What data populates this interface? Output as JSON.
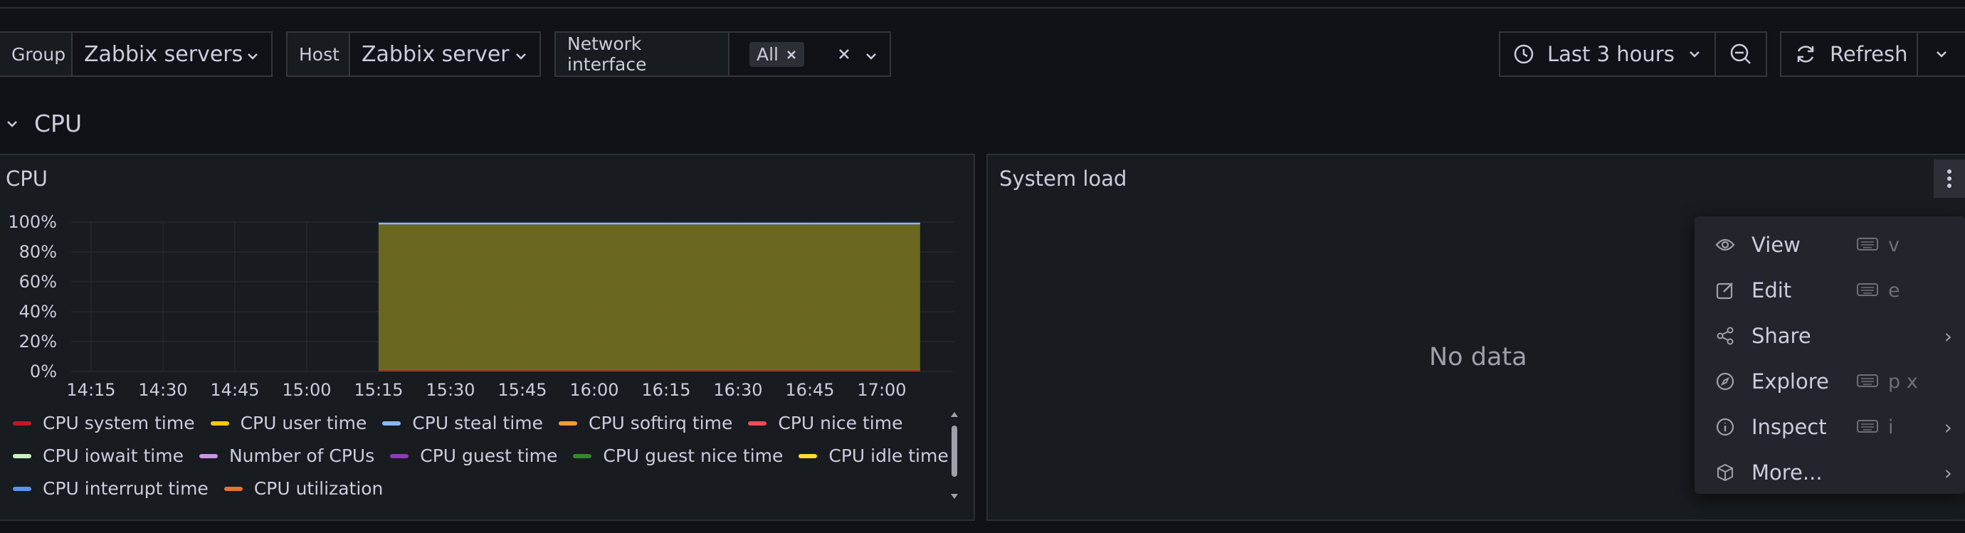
{
  "variables": {
    "group": {
      "label": "Group",
      "value": "Zabbix servers"
    },
    "host": {
      "label": "Host",
      "value": "Zabbix server"
    },
    "network": {
      "label": "Network interface",
      "chip": "All"
    }
  },
  "toolbar": {
    "time_range": "Last 3 hours",
    "refresh": "Refresh"
  },
  "row": {
    "title": "CPU"
  },
  "cpu_panel": {
    "title": "CPU",
    "chart_data": {
      "type": "area",
      "y_ticks": [
        "100%",
        "80%",
        "60%",
        "40%",
        "20%",
        "0%"
      ],
      "x_ticks": [
        "14:15",
        "14:30",
        "14:45",
        "15:00",
        "15:15",
        "15:30",
        "15:45",
        "16:00",
        "16:15",
        "16:30",
        "16:45",
        "17:00"
      ],
      "ylim": [
        0,
        100
      ],
      "series": [
        {
          "name": "CPU system time",
          "color": "#c4162a"
        },
        {
          "name": "CPU user time",
          "color": "#f2cc0c"
        },
        {
          "name": "CPU steal time",
          "color": "#8ab8ff"
        },
        {
          "name": "CPU softirq time",
          "color": "#ff9830"
        },
        {
          "name": "CPU nice time",
          "color": "#f2495c"
        },
        {
          "name": "CPU iowait time",
          "color": "#c8f2c2"
        },
        {
          "name": "Number of CPUs",
          "color": "#ca95e5"
        },
        {
          "name": "CPU guest time",
          "color": "#8f3bb8"
        },
        {
          "name": "CPU guest nice time",
          "color": "#37872d"
        },
        {
          "name": "CPU idle time",
          "color": "#fade2a"
        },
        {
          "name": "CPU interrupt time",
          "color": "#5794f2"
        },
        {
          "name": "CPU utilization",
          "color": "#e0752d"
        }
      ],
      "idle_band": {
        "from": "15:15",
        "to": "17:08",
        "value": 99
      }
    }
  },
  "load_panel": {
    "title": "System load",
    "empty": "No data"
  },
  "menu": {
    "items": [
      {
        "label": "View",
        "key": "v",
        "icon": "eye-icon"
      },
      {
        "label": "Edit",
        "key": "e",
        "icon": "edit-icon"
      },
      {
        "label": "Share",
        "key": "",
        "icon": "share-icon"
      },
      {
        "label": "Explore",
        "key": "p x",
        "icon": "compass-icon"
      },
      {
        "label": "Inspect",
        "key": "i",
        "icon": "info-icon"
      },
      {
        "label": "More...",
        "key": "",
        "icon": "cube-icon"
      }
    ]
  }
}
